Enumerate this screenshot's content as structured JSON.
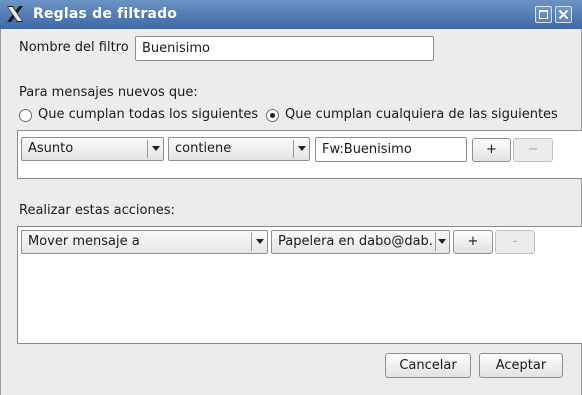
{
  "window": {
    "title": "Reglas de filtrado",
    "app_icon": "x-logo-icon"
  },
  "filter": {
    "name_label": "Nombre del filtro",
    "name_value": "Buenisimo"
  },
  "conditions": {
    "heading": "Para mensajes nuevos que:",
    "match_all_label": "Que cumplan todas los siguientes",
    "match_any_label": "Que cumplan cualquiera de las siguientes",
    "selected": "any",
    "rules": [
      {
        "field": "Asunto",
        "operator": "contiene",
        "value": "Fw:Buenisimo",
        "add_label": "+",
        "remove_label": "−"
      }
    ]
  },
  "actions": {
    "heading": "Realizar estas acciones:",
    "rules": [
      {
        "action": "Mover mensaje a",
        "target": "Papelera en dabo@dab...",
        "add_label": "+",
        "remove_label": "-"
      }
    ]
  },
  "buttons": {
    "cancel": "Cancelar",
    "accept": "Aceptar"
  },
  "colors": {
    "titlebar": "#4f78b3",
    "background": "#ececec"
  }
}
